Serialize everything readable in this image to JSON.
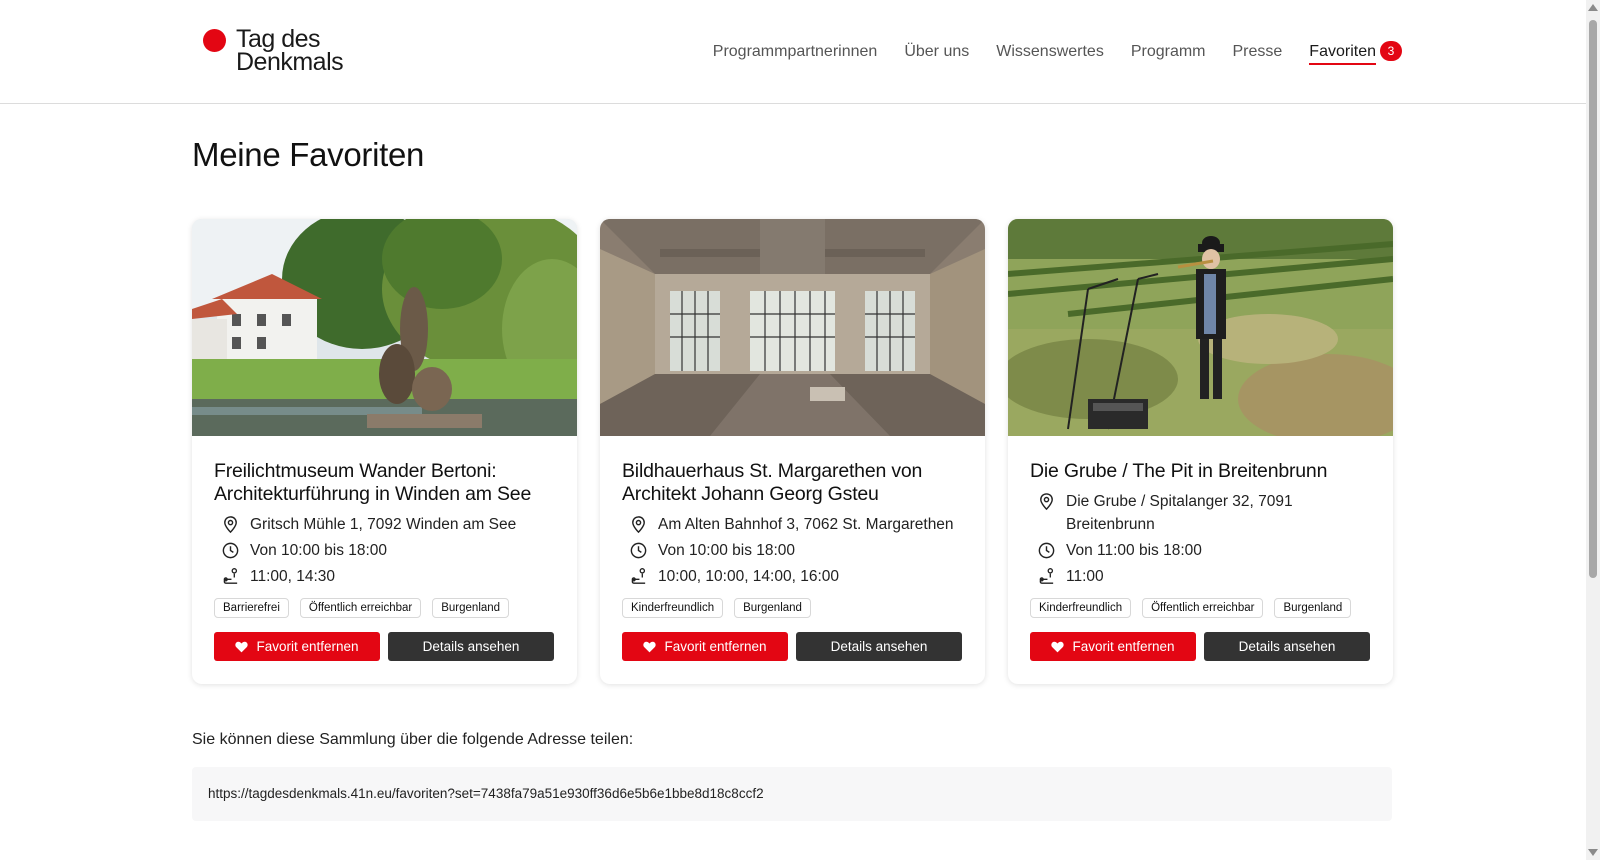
{
  "header": {
    "logo_line1": "Tag des",
    "logo_line2": "Denkmals",
    "nav": [
      {
        "label": "Programmpartnerinnen"
      },
      {
        "label": "Über uns"
      },
      {
        "label": "Wissenswertes"
      },
      {
        "label": "Programm"
      },
      {
        "label": "Presse"
      },
      {
        "label": "Favoriten",
        "badge": "3",
        "active": true
      }
    ]
  },
  "main": {
    "title": "Meine Favoriten",
    "cards": [
      {
        "title": "Freilichtmuseum Wander Bertoni: Architekturführung in Winden am See",
        "address": "Gritsch Mühle 1, 7092 Winden am See",
        "hours": "Von 10:00 bis 18:00",
        "tours": "11:00, 14:30",
        "tags": [
          "Barrierefrei",
          "Öffentlich erreichbar",
          "Burgenland"
        ],
        "remove_label": "Favorit entfernen",
        "details_label": "Details ansehen"
      },
      {
        "title": "Bildhauerhaus St. Margarethen von Architekt Johann Georg Gsteu",
        "address": "Am Alten Bahnhof 3, 7062 St. Margarethen",
        "hours": "Von 10:00 bis 18:00",
        "tours": "10:00, 10:00, 14:00, 16:00",
        "tags": [
          "Kinderfreundlich",
          "Burgenland"
        ],
        "remove_label": "Favorit entfernen",
        "details_label": "Details ansehen"
      },
      {
        "title": "Die Grube / The Pit in Breitenbrunn",
        "address_line1": "Die Grube / Spitalanger 32, 7091",
        "address_line2": "Breitenbrunn",
        "hours": "Von 11:00 bis 18:00",
        "tours": "11:00",
        "tags": [
          "Kinderfreundlich",
          "Öffentlich erreichbar",
          "Burgenland"
        ],
        "remove_label": "Favorit entfernen",
        "details_label": "Details ansehen"
      }
    ],
    "share_label": "Sie können diese Sammlung über die folgende Adresse teilen:",
    "share_url": "https://tagdesdenkmals.41n.eu/favoriten?set=7438fa79a51e930ff36d6e5b6e1bbe8d18c8ccf2"
  },
  "colors": {
    "accent": "#e30613",
    "dark_button": "#333333",
    "share_bg": "#f7f7f8"
  }
}
